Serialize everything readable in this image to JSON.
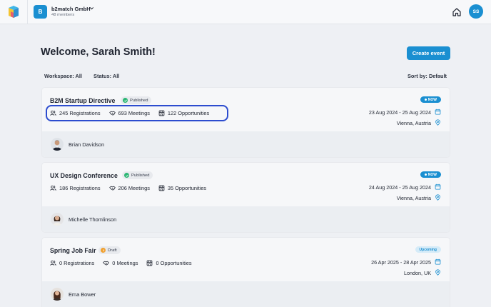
{
  "topbar": {
    "org_initial": "B",
    "org_name": "b2match GmbH",
    "org_members": "48 members",
    "user_initials": "SS"
  },
  "header": {
    "welcome": "Welcome, Sarah Smith!",
    "create_button": "Create event"
  },
  "filters": {
    "workspace": "Workspace: All",
    "status": "Status: All",
    "sort": "Sort by: Default"
  },
  "events": [
    {
      "title": "B2M Startup Directive",
      "status": "Published",
      "registrations": "245 Registrations",
      "meetings": "693 Meetings",
      "opportunities": "122 Opportunities",
      "pill": "NOW",
      "date": "23 Aug 2024 - 25 Aug 2024",
      "location": "Vienna, Austria",
      "person": "Brian Davidson"
    },
    {
      "title": "UX Design Conference",
      "status": "Published",
      "registrations": "186 Registrations",
      "meetings": "206 Meetings",
      "opportunities": "35 Opportunities",
      "pill": "NOW",
      "date": "24 Aug 2024 - 25 Aug 2024",
      "location": "Vienna, Austria",
      "person": "Michelle Thomlinson"
    },
    {
      "title": "Spring Job Fair",
      "status": "Draft",
      "registrations": "0 Registrations",
      "meetings": "0 Meetings",
      "opportunities": "0 Opportunities",
      "pill": "Upcoming",
      "date": "26 Apr 2025 - 28 Apr 2025",
      "location": "London, UK",
      "person": "Ema Bower"
    }
  ],
  "colors": {
    "accent": "#1a8fd1",
    "published": "#2bb673",
    "draft": "#f0a030",
    "highlight": "#2c4ccf"
  }
}
